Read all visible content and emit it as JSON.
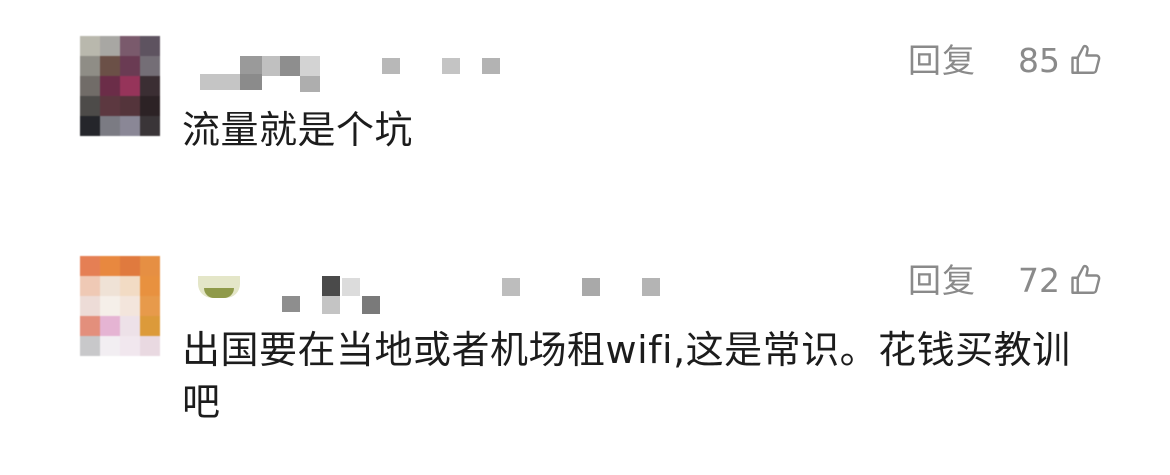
{
  "comments": [
    {
      "reply_label": "回复",
      "likes": "85",
      "text": "流量就是个坑",
      "avatar_icon": "pixelated-avatar-icon",
      "like_icon": "thumbs-up-icon"
    },
    {
      "reply_label": "回复",
      "likes": "72",
      "text": "出国要在当地或者机场租wifi,这是常识。花钱买教训吧",
      "avatar_icon": "pixelated-avatar-icon",
      "like_icon": "thumbs-up-icon"
    }
  ]
}
